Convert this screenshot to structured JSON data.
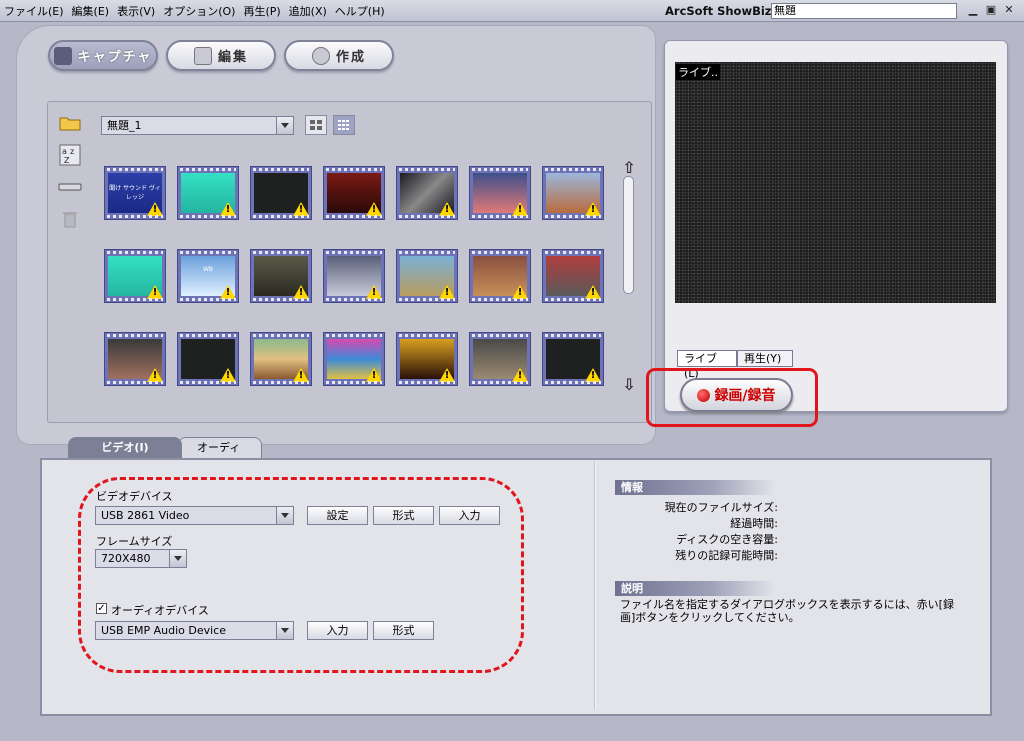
{
  "menubar": {
    "items": [
      "ファイル(E)",
      "編集(E)",
      "表示(V)",
      "オプション(O)",
      "再生(P)",
      "追加(X)",
      "ヘルプ(H)"
    ],
    "app_title": "ArcSoft ShowBiz",
    "document_title": "無題"
  },
  "mode_tabs": {
    "capture": "キャプチャ",
    "edit": "編集",
    "create": "作成"
  },
  "gallery": {
    "album_value": "無題_1",
    "thumbnails": [
      {
        "bg": "linear-gradient(#2c3ea8,#1b2a86)",
        "text": "聞け サウンド ヴィレッジ"
      },
      {
        "bg": "linear-gradient(#34e0c3,#24b5a0)",
        "text": ""
      },
      {
        "bg": "#1f2020",
        "text": ""
      },
      {
        "bg": "linear-gradient(#7a1a14,#2a0a08)",
        "text": ""
      },
      {
        "bg": "linear-gradient(135deg,#1b1b22,#888,#1b1b22)",
        "text": ""
      },
      {
        "bg": "linear-gradient(#3d4f8a,#e17a7a)",
        "text": ""
      },
      {
        "bg": "linear-gradient(#9cb6dc,#b86c3c)",
        "text": ""
      },
      {
        "bg": "linear-gradient(#34e0c3,#24b5a0)",
        "text": ""
      },
      {
        "bg": "linear-gradient(#6aa0dc,#e0f0ff)",
        "text": "WB"
      },
      {
        "bg": "linear-gradient(#5a5a4a,#2a2a22)",
        "text": ""
      },
      {
        "bg": "linear-gradient(#5a607a,#c7cad8)",
        "text": ""
      },
      {
        "bg": "linear-gradient(#7bb1d6,#b89c5e)",
        "text": ""
      },
      {
        "bg": "linear-gradient(#8a5040,#c79058)",
        "text": ""
      },
      {
        "bg": "linear-gradient(#b03d3d,#5a5a5a)",
        "text": ""
      },
      {
        "bg": "linear-gradient(#3a3a3a,#a07060)",
        "text": ""
      },
      {
        "bg": "#1f2020",
        "text": ""
      },
      {
        "bg": "linear-gradient(#8cb98c,#e0c080,#8c5a30)",
        "text": ""
      },
      {
        "bg": "linear-gradient(#d84ab0,#3c8ad8,#e0c040)",
        "text": ""
      },
      {
        "bg": "linear-gradient(#d8a020,#2a1008)",
        "text": ""
      },
      {
        "bg": "linear-gradient(#4a4a4a,#9a8a70)",
        "text": ""
      },
      {
        "bg": "#1f2020",
        "text": ""
      }
    ]
  },
  "preview": {
    "label": "ライブ..",
    "tab_live": "ライブ(L)",
    "tab_play": "再生(Y)",
    "record_label": "録画/録音"
  },
  "bottom_tabs": {
    "video": "ビデオ(I)",
    "audio": "オーディオ(U)"
  },
  "video_settings": {
    "device_label": "ビデオデバイス",
    "device_value": "USB 2861 Video",
    "settings_button": "設定",
    "format_button": "形式",
    "input_button": "入力",
    "frame_size_label": "フレームサイズ",
    "frame_size_value": "720X480",
    "audio_device_label": "オーディオデバイス",
    "audio_device_checked": true,
    "audio_device_value": "USB EMP Audio Device",
    "audio_input_button": "入力",
    "audio_format_button": "形式"
  },
  "info": {
    "header": "情報",
    "rows": [
      "現在のファイルサイズ:",
      "経過時間:",
      "ディスクの空き容量:",
      "残りの記録可能時間:"
    ],
    "desc_header": "説明",
    "desc_text": "ファイル名を指定するダイアログボックスを表示するには、赤い[録画]ボタンをクリックしてください。"
  }
}
